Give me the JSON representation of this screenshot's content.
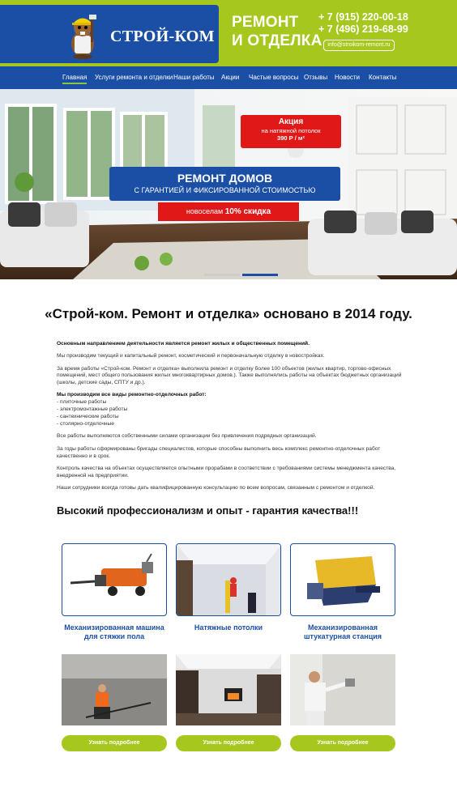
{
  "header": {
    "logo_text": "СТРОЙ-КОМ",
    "tagline_line1": "РЕМОНТ",
    "tagline_line2": "И ОТДЕЛКА",
    "phone1": "+ 7 (915) 220-00-18",
    "phone2": "+ 7 (496) 219-68-99",
    "email": "info@stroikom-remont.ru"
  },
  "nav": {
    "items": [
      {
        "label": "Главная"
      },
      {
        "label": "Услуги ремонта и отделки"
      },
      {
        "label": "Наши работы"
      },
      {
        "label": "Акции"
      },
      {
        "label": "Частые вопросы"
      },
      {
        "label": "Отзывы"
      },
      {
        "label": "Новости"
      },
      {
        "label": "Контакты"
      }
    ]
  },
  "hero": {
    "promo_title": "Акция",
    "promo_line": "на натяжной потолок",
    "promo_price": "390 Р / м²",
    "banner_title": "РЕМОНТ ДОМОВ",
    "banner_sub": "С ГАРАНТИЕЙ И ФИКСИРОВАННОЙ СТОИМОСТЬЮ",
    "discount_text": "новоселам",
    "discount_value": "10% скидка"
  },
  "content": {
    "heading": "«Строй-ком. Ремонт и отделка» основано в 2014 году.",
    "p1": "Основным направлением деятельности является ремонт жилых и общественных помещений.",
    "p2": "Мы производим текущий и капитальный ремонт, косметический и первоначальную отделку в новостройках.",
    "p3": "За время работы «Строй-ком. Ремонт и отделка» выполнила ремонт и отделку более 100 объектов (жилых квартир, торгово-офисных помещений, мест общего пользования жилых многоквартирных домов.). Также выполнялись работы на объектах бюджетных организаций (школы, детские сады, СПТУ и др.).",
    "list_title": "Мы производим все виды ремонтно-отделочных работ:",
    "list": [
      "- плиточные работы",
      "- электромонтажные работы",
      "- сантехнические работы",
      "- столярно-отделочные"
    ],
    "p4": "Все работы выполняются собственными силами организации без привлечения подрядных организаций.",
    "p5": "За годы работы сформированы бригады специалистов, которые способны выполнить весь комплекс ремонтно-отделочных работ качественно и в срок.",
    "p6": "Контроль качества на объектах осуществляется опытными прорабами в соответствии с требованиями системы менеджмента качества, внедренной на предприятии.",
    "p7": "Наши сотрудники всегда готовы дать квалифицированную консультацию по всем вопросам, связанным с ремонтом и отделкой.",
    "subheading": "Высокий профессионализм и опыт - гарантия качества!!!"
  },
  "cards": [
    {
      "title_line1": "Механизированная машина",
      "title_line2": "для стяжки пола",
      "button": "Узнать подробнее"
    },
    {
      "title_line1": "Натяжные потолки",
      "title_line2": "",
      "button": "Узнать подробнее"
    },
    {
      "title_line1": "Механизированная",
      "title_line2": "штукатурная станция",
      "button": "Узнать подробнее"
    }
  ],
  "colors": {
    "brand_blue": "#1b4fa6",
    "brand_green": "#a6c81e",
    "accent_red": "#e01818"
  }
}
